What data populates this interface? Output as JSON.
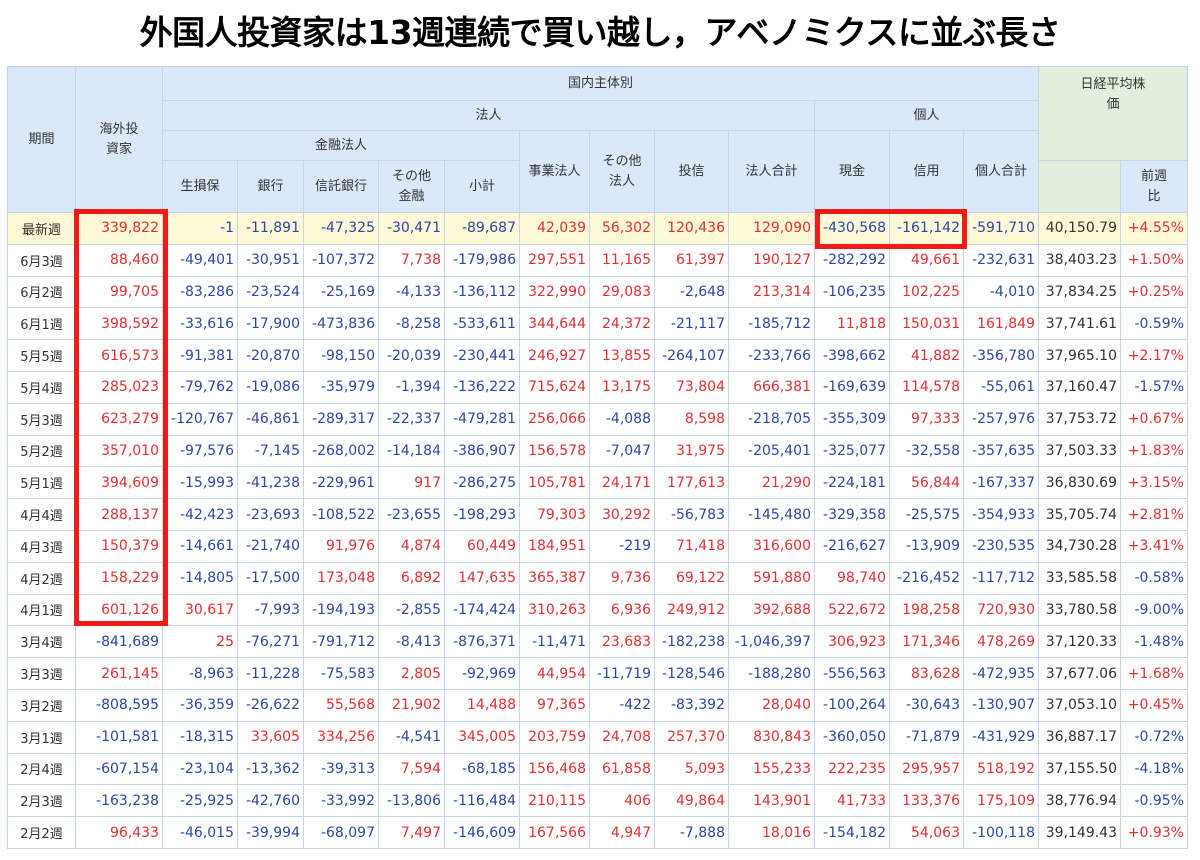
{
  "title": "外国人投資家は13週連続で買い越し，アベノミクスに並ぶ長さ",
  "colors": {
    "positive": "#e03030",
    "negative": "#2b47a8",
    "highlight": "#ee1b1b",
    "latest_row_bg": "#fdf8d5"
  },
  "headers": {
    "period": "期間",
    "foreign": "海外投資家",
    "domestic": "国内主体別",
    "corporate": "法人",
    "financial": "金融法人",
    "individual_group": "個人",
    "nikkei": "日経平均株価",
    "life_insurance": "生損保",
    "bank": "銀行",
    "trust_bank": "信託銀行",
    "other_finance": "その他金融",
    "subtotal": "小計",
    "business": "事業法人",
    "other_corp": "その他法人",
    "investment_trust": "投信",
    "corp_total": "法人合計",
    "cash": "現金",
    "margin": "信用",
    "individual_total": "個人合計",
    "prev_week": "前週比"
  },
  "rows": [
    {
      "period": "最新週",
      "foreign": "339,822",
      "life": "-1",
      "bank": "-11,891",
      "trust": "-47,325",
      "other_fin": "-30,471",
      "subtotal": "-89,687",
      "business": "42,039",
      "other_corp": "56,302",
      "itrust": "120,436",
      "corp_total": "129,090",
      "cash": "-430,568",
      "margin": "-161,142",
      "ind_total": "-591,710",
      "nikkei": "40,150.79",
      "change": "+4.55%"
    },
    {
      "period": "6月3週",
      "foreign": "88,460",
      "life": "-49,401",
      "bank": "-30,951",
      "trust": "-107,372",
      "other_fin": "7,738",
      "subtotal": "-179,986",
      "business": "297,551",
      "other_corp": "11,165",
      "itrust": "61,397",
      "corp_total": "190,127",
      "cash": "-282,292",
      "margin": "49,661",
      "ind_total": "-232,631",
      "nikkei": "38,403.23",
      "change": "+1.50%"
    },
    {
      "period": "6月2週",
      "foreign": "99,705",
      "life": "-83,286",
      "bank": "-23,524",
      "trust": "-25,169",
      "other_fin": "-4,133",
      "subtotal": "-136,112",
      "business": "322,990",
      "other_corp": "29,083",
      "itrust": "-2,648",
      "corp_total": "213,314",
      "cash": "-106,235",
      "margin": "102,225",
      "ind_total": "-4,010",
      "nikkei": "37,834.25",
      "change": "+0.25%"
    },
    {
      "period": "6月1週",
      "foreign": "398,592",
      "life": "-33,616",
      "bank": "-17,900",
      "trust": "-473,836",
      "other_fin": "-8,258",
      "subtotal": "-533,611",
      "business": "344,644",
      "other_corp": "24,372",
      "itrust": "-21,117",
      "corp_total": "-185,712",
      "cash": "11,818",
      "margin": "150,031",
      "ind_total": "161,849",
      "nikkei": "37,741.61",
      "change": "-0.59%"
    },
    {
      "period": "5月5週",
      "foreign": "616,573",
      "life": "-91,381",
      "bank": "-20,870",
      "trust": "-98,150",
      "other_fin": "-20,039",
      "subtotal": "-230,441",
      "business": "246,927",
      "other_corp": "13,855",
      "itrust": "-264,107",
      "corp_total": "-233,766",
      "cash": "-398,662",
      "margin": "41,882",
      "ind_total": "-356,780",
      "nikkei": "37,965.10",
      "change": "+2.17%"
    },
    {
      "period": "5月4週",
      "foreign": "285,023",
      "life": "-79,762",
      "bank": "-19,086",
      "trust": "-35,979",
      "other_fin": "-1,394",
      "subtotal": "-136,222",
      "business": "715,624",
      "other_corp": "13,175",
      "itrust": "73,804",
      "corp_total": "666,381",
      "cash": "-169,639",
      "margin": "114,578",
      "ind_total": "-55,061",
      "nikkei": "37,160.47",
      "change": "-1.57%"
    },
    {
      "period": "5月3週",
      "foreign": "623,279",
      "life": "-120,767",
      "bank": "-46,861",
      "trust": "-289,317",
      "other_fin": "-22,337",
      "subtotal": "-479,281",
      "business": "256,066",
      "other_corp": "-4,088",
      "itrust": "8,598",
      "corp_total": "-218,705",
      "cash": "-355,309",
      "margin": "97,333",
      "ind_total": "-257,976",
      "nikkei": "37,753.72",
      "change": "+0.67%"
    },
    {
      "period": "5月2週",
      "foreign": "357,010",
      "life": "-97,576",
      "bank": "-7,145",
      "trust": "-268,002",
      "other_fin": "-14,184",
      "subtotal": "-386,907",
      "business": "156,578",
      "other_corp": "-7,047",
      "itrust": "31,975",
      "corp_total": "-205,401",
      "cash": "-325,077",
      "margin": "-32,558",
      "ind_total": "-357,635",
      "nikkei": "37,503.33",
      "change": "+1.83%"
    },
    {
      "period": "5月1週",
      "foreign": "394,609",
      "life": "-15,993",
      "bank": "-41,238",
      "trust": "-229,961",
      "other_fin": "917",
      "subtotal": "-286,275",
      "business": "105,781",
      "other_corp": "24,171",
      "itrust": "177,613",
      "corp_total": "21,290",
      "cash": "-224,181",
      "margin": "56,844",
      "ind_total": "-167,337",
      "nikkei": "36,830.69",
      "change": "+3.15%"
    },
    {
      "period": "4月4週",
      "foreign": "288,137",
      "life": "-42,423",
      "bank": "-23,693",
      "trust": "-108,522",
      "other_fin": "-23,655",
      "subtotal": "-198,293",
      "business": "79,303",
      "other_corp": "30,292",
      "itrust": "-56,783",
      "corp_total": "-145,480",
      "cash": "-329,358",
      "margin": "-25,575",
      "ind_total": "-354,933",
      "nikkei": "35,705.74",
      "change": "+2.81%"
    },
    {
      "period": "4月3週",
      "foreign": "150,379",
      "life": "-14,661",
      "bank": "-21,740",
      "trust": "91,976",
      "other_fin": "4,874",
      "subtotal": "60,449",
      "business": "184,951",
      "other_corp": "-219",
      "itrust": "71,418",
      "corp_total": "316,600",
      "cash": "-216,627",
      "margin": "-13,909",
      "ind_total": "-230,535",
      "nikkei": "34,730.28",
      "change": "+3.41%"
    },
    {
      "period": "4月2週",
      "foreign": "158,229",
      "life": "-14,805",
      "bank": "-17,500",
      "trust": "173,048",
      "other_fin": "6,892",
      "subtotal": "147,635",
      "business": "365,387",
      "other_corp": "9,736",
      "itrust": "69,122",
      "corp_total": "591,880",
      "cash": "98,740",
      "margin": "-216,452",
      "ind_total": "-117,712",
      "nikkei": "33,585.58",
      "change": "-0.58%"
    },
    {
      "period": "4月1週",
      "foreign": "601,126",
      "life": "30,617",
      "bank": "-7,993",
      "trust": "-194,193",
      "other_fin": "-2,855",
      "subtotal": "-174,424",
      "business": "310,263",
      "other_corp": "6,936",
      "itrust": "249,912",
      "corp_total": "392,688",
      "cash": "522,672",
      "margin": "198,258",
      "ind_total": "720,930",
      "nikkei": "33,780.58",
      "change": "-9.00%"
    },
    {
      "period": "3月4週",
      "foreign": "-841,689",
      "life": "25",
      "bank": "-76,271",
      "trust": "-791,712",
      "other_fin": "-8,413",
      "subtotal": "-876,371",
      "business": "-11,471",
      "other_corp": "23,683",
      "itrust": "-182,238",
      "corp_total": "-1,046,397",
      "cash": "306,923",
      "margin": "171,346",
      "ind_total": "478,269",
      "nikkei": "37,120.33",
      "change": "-1.48%"
    },
    {
      "period": "3月3週",
      "foreign": "261,145",
      "life": "-8,963",
      "bank": "-11,228",
      "trust": "-75,583",
      "other_fin": "2,805",
      "subtotal": "-92,969",
      "business": "44,954",
      "other_corp": "-11,719",
      "itrust": "-128,546",
      "corp_total": "-188,280",
      "cash": "-556,563",
      "margin": "83,628",
      "ind_total": "-472,935",
      "nikkei": "37,677.06",
      "change": "+1.68%"
    },
    {
      "period": "3月2週",
      "foreign": "-808,595",
      "life": "-36,359",
      "bank": "-26,622",
      "trust": "55,568",
      "other_fin": "21,902",
      "subtotal": "14,488",
      "business": "97,365",
      "other_corp": "-422",
      "itrust": "-83,392",
      "corp_total": "28,040",
      "cash": "-100,264",
      "margin": "-30,643",
      "ind_total": "-130,907",
      "nikkei": "37,053.10",
      "change": "+0.45%"
    },
    {
      "period": "3月1週",
      "foreign": "-101,581",
      "life": "-18,315",
      "bank": "33,605",
      "trust": "334,256",
      "other_fin": "-4,541",
      "subtotal": "345,005",
      "business": "203,759",
      "other_corp": "24,708",
      "itrust": "257,370",
      "corp_total": "830,843",
      "cash": "-360,050",
      "margin": "-71,879",
      "ind_total": "-431,929",
      "nikkei": "36,887.17",
      "change": "-0.72%"
    },
    {
      "period": "2月4週",
      "foreign": "-607,154",
      "life": "-23,104",
      "bank": "-13,362",
      "trust": "-39,313",
      "other_fin": "7,594",
      "subtotal": "-68,185",
      "business": "156,468",
      "other_corp": "61,858",
      "itrust": "5,093",
      "corp_total": "155,233",
      "cash": "222,235",
      "margin": "295,957",
      "ind_total": "518,192",
      "nikkei": "37,155.50",
      "change": "-4.18%"
    },
    {
      "period": "2月3週",
      "foreign": "-163,238",
      "life": "-25,925",
      "bank": "-42,760",
      "trust": "-33,992",
      "other_fin": "-13,806",
      "subtotal": "-116,484",
      "business": "210,115",
      "other_corp": "406",
      "itrust": "49,864",
      "corp_total": "143,901",
      "cash": "41,733",
      "margin": "133,376",
      "ind_total": "175,109",
      "nikkei": "38,776.94",
      "change": "-0.95%"
    },
    {
      "period": "2月2週",
      "foreign": "96,433",
      "life": "-46,015",
      "bank": "-39,994",
      "trust": "-68,097",
      "other_fin": "7,497",
      "subtotal": "-146,609",
      "business": "167,566",
      "other_corp": "4,947",
      "itrust": "-7,888",
      "corp_total": "18,016",
      "cash": "-154,182",
      "margin": "54,063",
      "ind_total": "-100,118",
      "nikkei": "39,149.43",
      "change": "+0.93%"
    }
  ]
}
